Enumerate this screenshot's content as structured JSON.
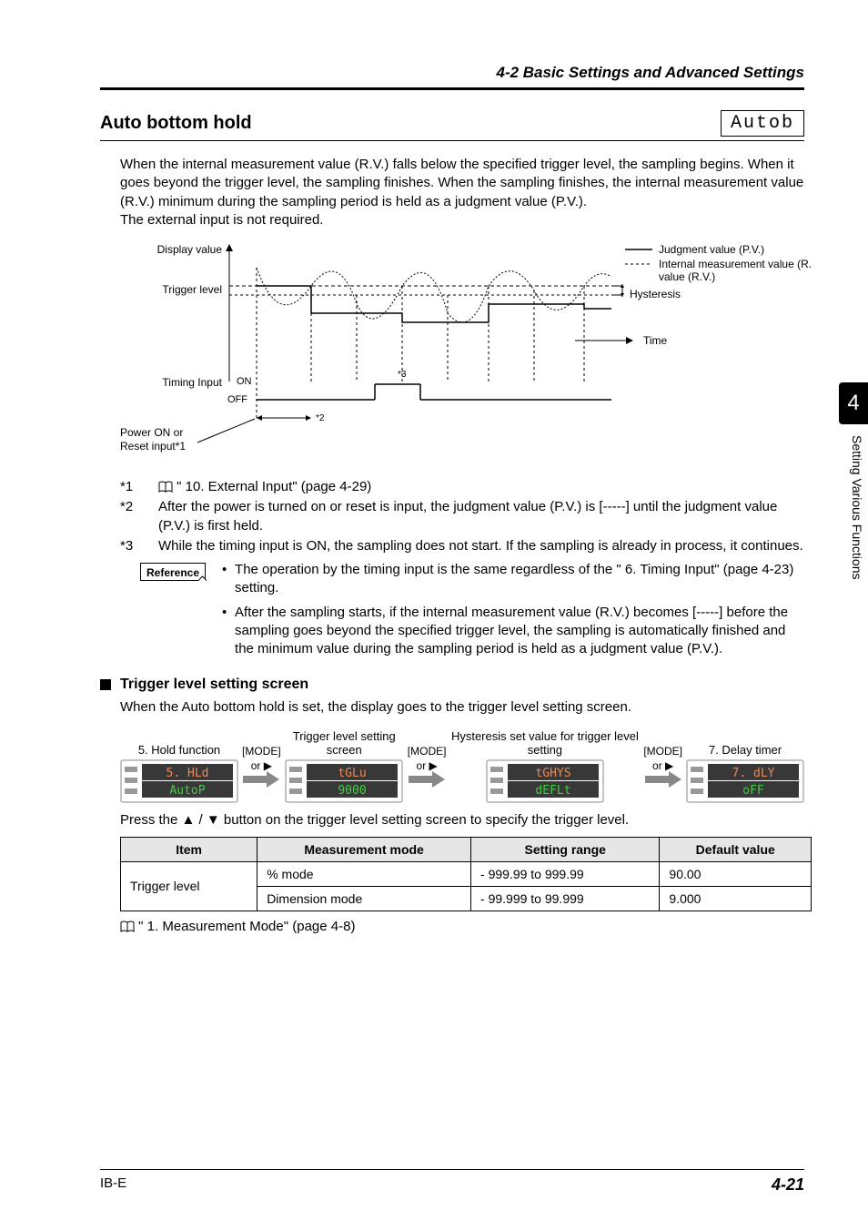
{
  "section_header": "4-2  Basic Settings and Advanced Settings",
  "heading": "Auto bottom hold",
  "seg_display": "Autob",
  "intro_para": "When the internal measurement value (R.V.) falls below the specified trigger level, the sampling begins. When it goes beyond the trigger level, the sampling finishes. When the sampling finishes, the internal measurement value (R.V.) minimum during the sampling period is held as a judgment value (P.V.).",
  "intro_para2": "The external input is not required.",
  "diagram": {
    "display_value": "Display value",
    "trigger_level": "Trigger level",
    "timing_input": "Timing Input",
    "on": "ON",
    "off": "OFF",
    "power_on": "Power ON or",
    "reset_input": "Reset input*1",
    "judgment_value": "Judgment value (P.V.)",
    "internal_meas": "Internal measurement value (R.V.)",
    "hysteresis": "Hysteresis",
    "time": "Time",
    "star2": "*2",
    "star3": "*3"
  },
  "footnotes": {
    "f1_label": "*1",
    "f1_text": "\" 10. External Input\" (page 4-29)",
    "f2_label": "*2",
    "f2_text": "After the power is turned on or reset is input, the judgment value (P.V.) is [-----] until the judgment value (P.V.) is first held.",
    "f3_label": "*3",
    "f3_text": "While the timing input is ON, the sampling does not start. If the sampling is already in process, it continues."
  },
  "reference": {
    "label": "Reference",
    "b1": "The operation by the timing input is the same regardless of the \" 6. Timing Input\" (page 4-23) setting.",
    "b2": "After the sampling starts, if the internal measurement value (R.V.) becomes [-----] before the sampling goes beyond the specified trigger level, the sampling is automatically finished and the minimum value during the sampling period is held as a judgment value (P.V.)."
  },
  "subhead": "Trigger level setting screen",
  "subhead_desc": "When the Auto bottom hold is set, the display goes to the trigger level setting screen.",
  "flow": {
    "step1_top": "5. Hold function",
    "step1_l1": "5. HLd",
    "step1_l2": "AutoP",
    "mode": "[MODE]",
    "or": "or ▶",
    "step2_top": "Trigger level setting screen",
    "step2_l1": "tGLu",
    "step2_l2": "9000",
    "step3_top": "Hysteresis set value for trigger level setting",
    "step3_l1": "tGHYS",
    "step3_l2": "dEFLt",
    "step4_top": "7. Delay timer",
    "step4_l1": "7. dLY",
    "step4_l2": "oFF"
  },
  "press_text": "Press the ▲ / ▼ button on the trigger level setting screen to specify the trigger level.",
  "table": {
    "h1": "Item",
    "h2": "Measurement mode",
    "h3": "Setting range",
    "h4": "Default value",
    "r1c1": "Trigger level",
    "r1c2": "% mode",
    "r1c3": "- 999.99 to 999.99",
    "r1c4": "90.00",
    "r2c2": "Dimension mode",
    "r2c3": "- 99.999 to 99.999",
    "r2c4": "9.000"
  },
  "xref": "\" 1. Measurement Mode\" (page 4-8)",
  "side_tab": "4",
  "side_text": "Setting Various Functions",
  "footer_left": "IB-E",
  "footer_right": "4-21"
}
